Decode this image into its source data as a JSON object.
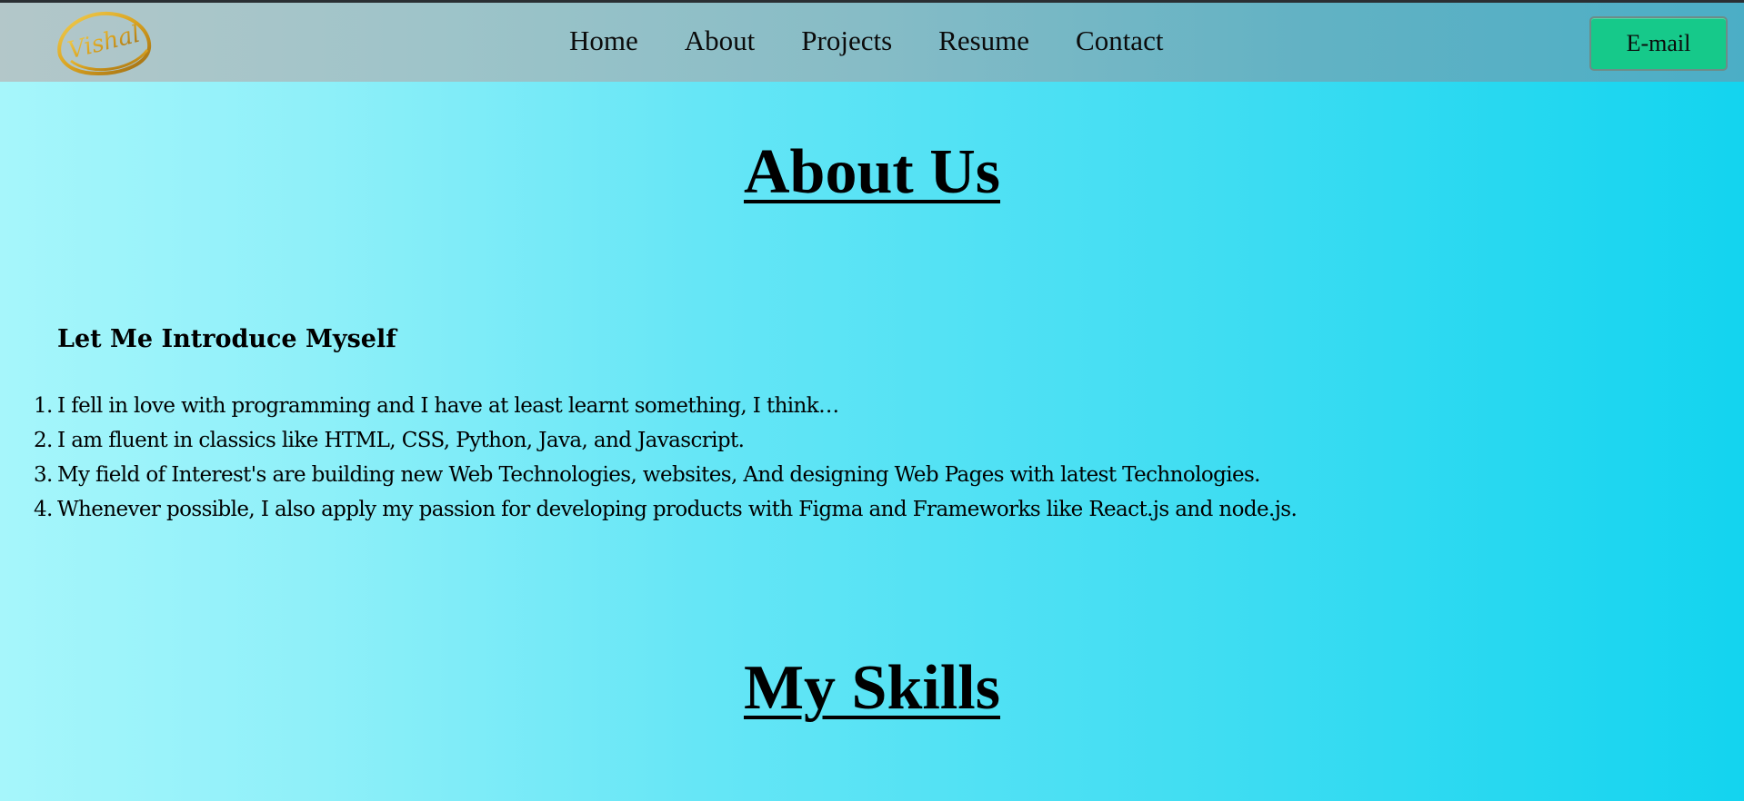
{
  "nav": {
    "logo_text": "Vishal",
    "links": [
      "Home",
      "About",
      "Projects",
      "Resume",
      "Contact"
    ],
    "email_button": "E-mail"
  },
  "about": {
    "title": "About Us",
    "intro_heading": "Let Me Introduce Myself",
    "items": [
      {
        "num": "1.",
        "text": "I fell in love with programming and I have at least learnt something, I think…"
      },
      {
        "num": "2.",
        "text": "I am fluent in classics like HTML, CSS, Python, Java, and Javascript."
      },
      {
        "num": "3.",
        "text": "My field of Interest's are building new Web Technologies, websites, And designing Web Pages with latest Technologies."
      },
      {
        "num": "4.",
        "text": "Whenever possible, I also apply my passion for developing products with Figma and Frameworks like React.js and node.js."
      }
    ]
  },
  "skills": {
    "title": "My Skills"
  },
  "colors": {
    "email_button_bg": "#16c98a",
    "logo_gold": "#d9a21f",
    "page_gradient_start": "#a6f6fb",
    "page_gradient_end": "#13d4ef"
  }
}
